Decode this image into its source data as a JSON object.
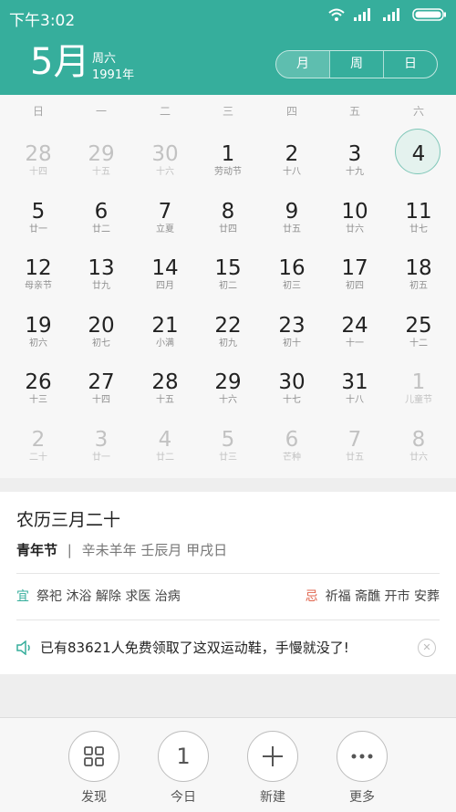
{
  "status_bar": {
    "time": "下午3:02",
    "icons": [
      "wifi-icon",
      "signal-icon",
      "signal-icon",
      "battery-icon"
    ]
  },
  "header": {
    "month": "5月",
    "weekday": "周六",
    "year": "1991年",
    "view_tabs": [
      "月",
      "周",
      "日"
    ],
    "active_tab": "月",
    "color": "#36ae9c"
  },
  "calendar": {
    "weekdays": [
      "日",
      "一",
      "二",
      "三",
      "四",
      "五",
      "六"
    ],
    "selected_day": "4",
    "weeks": [
      [
        {
          "d": "28",
          "s": "十四",
          "other": true
        },
        {
          "d": "29",
          "s": "十五",
          "other": true
        },
        {
          "d": "30",
          "s": "十六",
          "other": true
        },
        {
          "d": "1",
          "s": "劳动节"
        },
        {
          "d": "2",
          "s": "十八"
        },
        {
          "d": "3",
          "s": "十九"
        },
        {
          "d": "4",
          "s": "",
          "selected": true
        }
      ],
      [
        {
          "d": "5",
          "s": "廿一"
        },
        {
          "d": "6",
          "s": "廿二"
        },
        {
          "d": "7",
          "s": "立夏"
        },
        {
          "d": "8",
          "s": "廿四"
        },
        {
          "d": "9",
          "s": "廿五"
        },
        {
          "d": "10",
          "s": "廿六"
        },
        {
          "d": "11",
          "s": "廿七"
        }
      ],
      [
        {
          "d": "12",
          "s": "母亲节"
        },
        {
          "d": "13",
          "s": "廿九"
        },
        {
          "d": "14",
          "s": "四月"
        },
        {
          "d": "15",
          "s": "初二"
        },
        {
          "d": "16",
          "s": "初三"
        },
        {
          "d": "17",
          "s": "初四"
        },
        {
          "d": "18",
          "s": "初五"
        }
      ],
      [
        {
          "d": "19",
          "s": "初六"
        },
        {
          "d": "20",
          "s": "初七"
        },
        {
          "d": "21",
          "s": "小满"
        },
        {
          "d": "22",
          "s": "初九"
        },
        {
          "d": "23",
          "s": "初十"
        },
        {
          "d": "24",
          "s": "十一"
        },
        {
          "d": "25",
          "s": "十二"
        }
      ],
      [
        {
          "d": "26",
          "s": "十三"
        },
        {
          "d": "27",
          "s": "十四"
        },
        {
          "d": "28",
          "s": "十五"
        },
        {
          "d": "29",
          "s": "十六"
        },
        {
          "d": "30",
          "s": "十七"
        },
        {
          "d": "31",
          "s": "十八"
        },
        {
          "d": "1",
          "s": "儿童节",
          "other": true
        }
      ],
      [
        {
          "d": "2",
          "s": "二十",
          "other": true
        },
        {
          "d": "3",
          "s": "廿一",
          "other": true
        },
        {
          "d": "4",
          "s": "廿二",
          "other": true
        },
        {
          "d": "5",
          "s": "廿三",
          "other": true
        },
        {
          "d": "6",
          "s": "芒种",
          "other": true
        },
        {
          "d": "7",
          "s": "廿五",
          "other": true
        },
        {
          "d": "8",
          "s": "廿六",
          "other": true
        }
      ]
    ]
  },
  "info": {
    "lunar_date": "农历三月二十",
    "festival": "青年节",
    "separator": "|",
    "ganzhi": "辛未羊年 壬辰月 甲戌日",
    "yi_label": "宜",
    "yi_items": "祭祀 沐浴 解除 求医 治病",
    "ji_label": "忌",
    "ji_items": "祈福 斋醮 开市 安葬",
    "ad_text": "已有83621人免费领取了这双运动鞋，手慢就没了!",
    "close_symbol": "✕"
  },
  "bottom_bar": {
    "buttons": [
      {
        "label": "发现",
        "icon": "grid-icon"
      },
      {
        "label": "今日",
        "icon_text": "1"
      },
      {
        "label": "新建",
        "icon": "plus-icon"
      },
      {
        "label": "更多",
        "icon": "more-dots-icon"
      }
    ]
  }
}
